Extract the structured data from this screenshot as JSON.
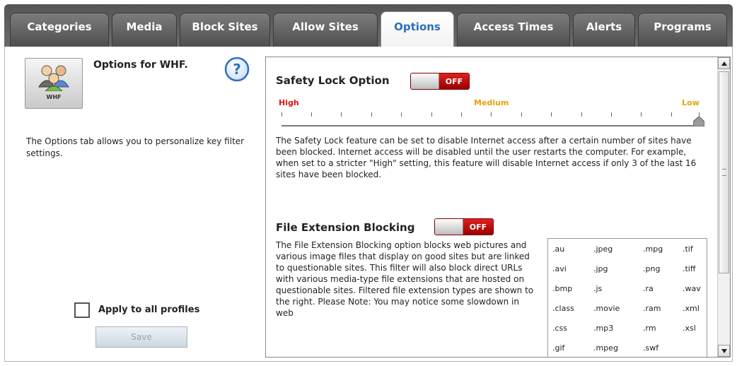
{
  "tabs": [
    {
      "label": "Categories",
      "active": false
    },
    {
      "label": "Media",
      "active": false
    },
    {
      "label": "Block Sites",
      "active": false
    },
    {
      "label": "Allow Sites",
      "active": false
    },
    {
      "label": "Options",
      "active": true
    },
    {
      "label": "Access Times",
      "active": false
    },
    {
      "label": "Alerts",
      "active": false
    },
    {
      "label": "Programs",
      "active": false
    }
  ],
  "profile": {
    "tile_label": "WHF",
    "title": "Options for WHF.",
    "description": "The Options tab allows you to personalize key filter settings."
  },
  "apply_all": {
    "label": "Apply to all profiles",
    "checked": false
  },
  "save_button": {
    "label": "Save",
    "enabled": false
  },
  "safety_lock": {
    "title": "Safety Lock Option",
    "toggle_state": "OFF",
    "levels": {
      "high": "High",
      "medium": "Medium",
      "low": "Low"
    },
    "slider_value": "Low",
    "description": "The Safety Lock feature can be set to disable Internet access after a certain number of sites have been blocked.  Internet access will be disabled until the user restarts the computer.  For example, when set to a stricter \"High\" setting, this feature will disable Internet access if only 3 of the last 16 sites have been blocked."
  },
  "file_extension": {
    "title": "File Extension Blocking",
    "toggle_state": "OFF",
    "description": "The File Extension Blocking option blocks web pictures and various image files that display on good sites but are linked to questionable sites. This filter will also block direct URLs with various media-type file extensions that are hosted on questionable sites.  Filtered file extension types are shown to the right.  Please Note: You may notice some slowdown in web",
    "extensions": [
      [
        ".au",
        ".jpeg",
        ".mpg",
        ".tif"
      ],
      [
        ".avi",
        ".jpg",
        ".png",
        ".tiff"
      ],
      [
        ".bmp",
        ".js",
        ".ra",
        ".wav"
      ],
      [
        ".class",
        ".movie",
        ".ram",
        ".xml"
      ],
      [
        ".css",
        ".mp3",
        ".rm",
        ".xsl"
      ],
      [
        ".gif",
        ".mpeg",
        ".swf",
        ""
      ]
    ]
  },
  "colors": {
    "active_tab_text": "#2a6fbf",
    "toggle_off": "#c40000",
    "high_label": "#e01010",
    "medium_low_label": "#e6a100"
  }
}
